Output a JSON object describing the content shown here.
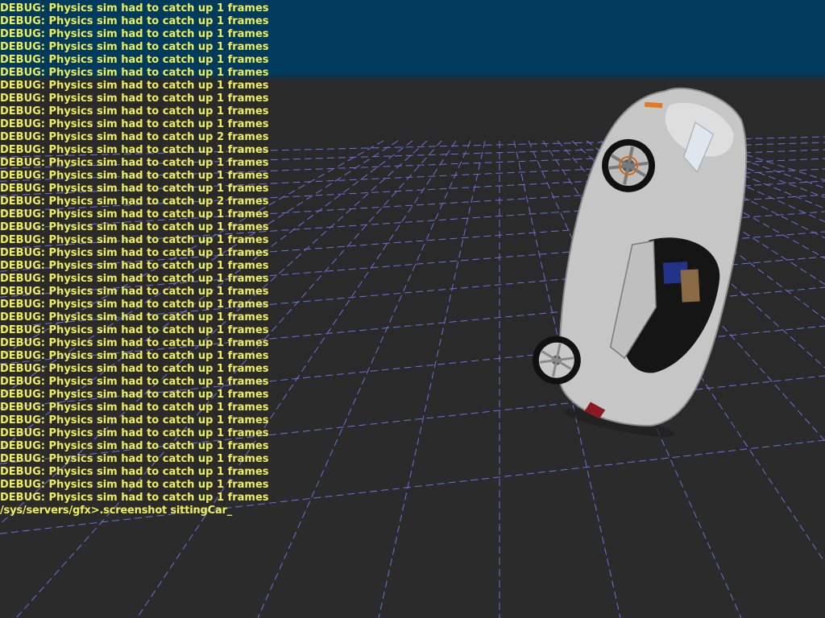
{
  "console": {
    "lines": [
      "DEBUG: Physics sim had to catch up 1 frames",
      "DEBUG: Physics sim had to catch up 1 frames",
      "DEBUG: Physics sim had to catch up 1 frames",
      "DEBUG: Physics sim had to catch up 1 frames",
      "DEBUG: Physics sim had to catch up 1 frames",
      "DEBUG: Physics sim had to catch up 1 frames",
      "DEBUG: Physics sim had to catch up 1 frames",
      "DEBUG: Physics sim had to catch up 1 frames",
      "DEBUG: Physics sim had to catch up 1 frames",
      "DEBUG: Physics sim had to catch up 1 frames",
      "DEBUG: Physics sim had to catch up 2 frames",
      "DEBUG: Physics sim had to catch up 1 frames",
      "DEBUG: Physics sim had to catch up 1 frames",
      "DEBUG: Physics sim had to catch up 1 frames",
      "DEBUG: Physics sim had to catch up 1 frames",
      "DEBUG: Physics sim had to catch up 2 frames",
      "DEBUG: Physics sim had to catch up 1 frames",
      "DEBUG: Physics sim had to catch up 1 frames",
      "DEBUG: Physics sim had to catch up 1 frames",
      "DEBUG: Physics sim had to catch up 1 frames",
      "DEBUG: Physics sim had to catch up 1 frames",
      "DEBUG: Physics sim had to catch up 1 frames",
      "DEBUG: Physics sim had to catch up 1 frames",
      "DEBUG: Physics sim had to catch up 1 frames",
      "DEBUG: Physics sim had to catch up 1 frames",
      "DEBUG: Physics sim had to catch up 1 frames",
      "DEBUG: Physics sim had to catch up 1 frames",
      "DEBUG: Physics sim had to catch up 1 frames",
      "DEBUG: Physics sim had to catch up 1 frames",
      "DEBUG: Physics sim had to catch up 1 frames",
      "DEBUG: Physics sim had to catch up 1 frames",
      "DEBUG: Physics sim had to catch up 1 frames",
      "DEBUG: Physics sim had to catch up 1 frames",
      "DEBUG: Physics sim had to catch up 1 frames",
      "DEBUG: Physics sim had to catch up 1 frames",
      "DEBUG: Physics sim had to catch up 1 frames",
      "DEBUG: Physics sim had to catch up 1 frames",
      "DEBUG: Physics sim had to catch up 1 frames",
      "DEBUG: Physics sim had to catch up 1 frames"
    ],
    "prompt_text": "/sys/servers/gfx>.screenshot  sittingCar_"
  },
  "colors": {
    "sky": "#003a5c",
    "ground": "#2b2b2b",
    "console_text": "#f0ef58",
    "grid_line": "#7b7bff",
    "car_body": "#c9c9c9"
  }
}
